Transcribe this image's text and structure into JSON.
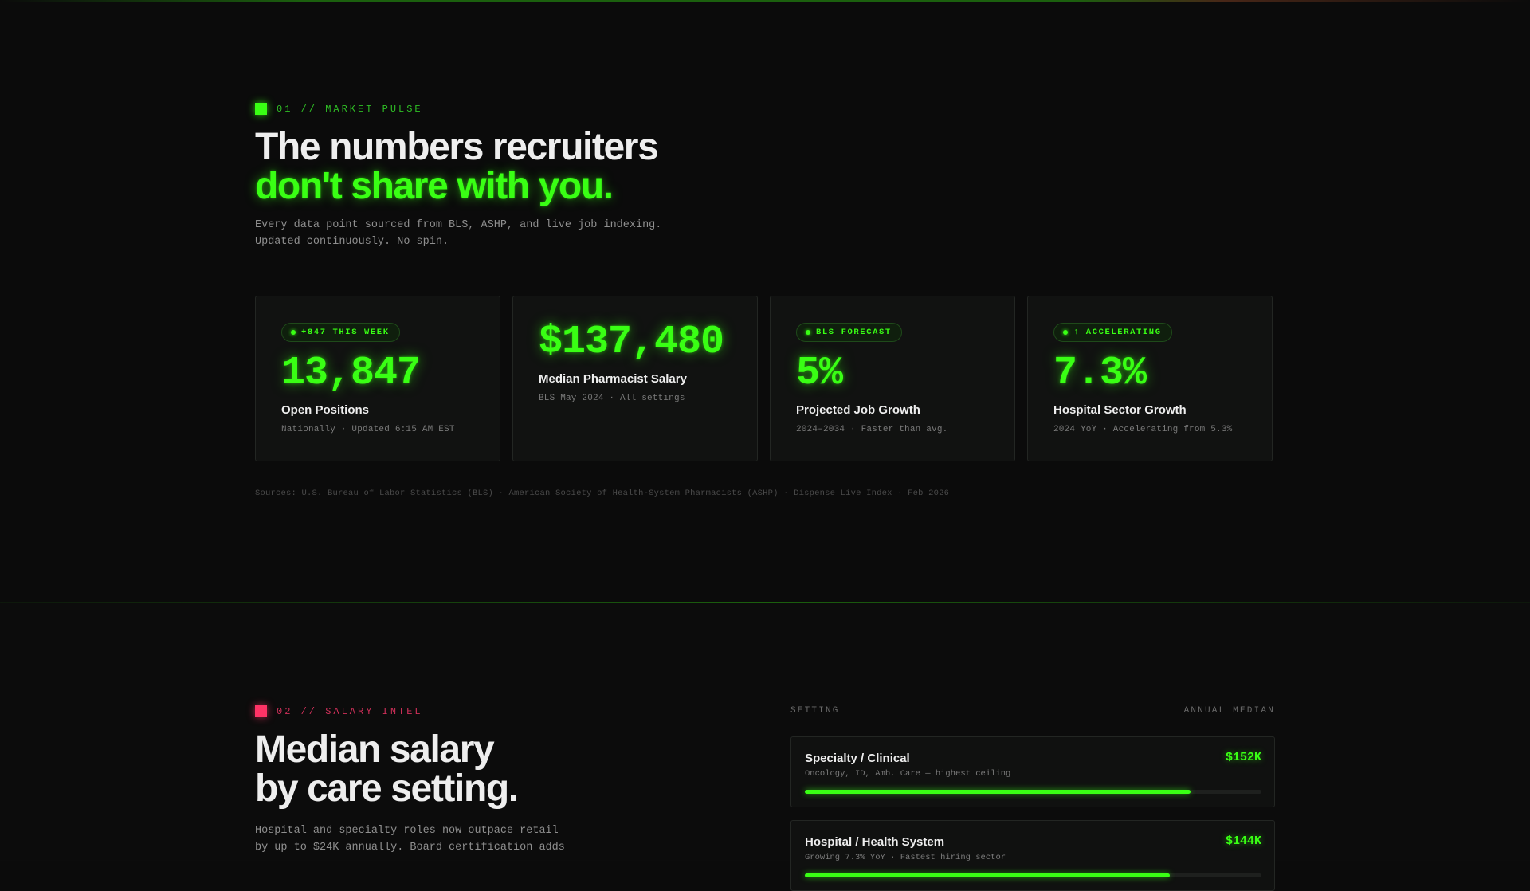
{
  "colors": {
    "accent": "#39ff14",
    "accent_secondary": "#ff3366",
    "background": "#0b0b0b",
    "card_bg": "#111211"
  },
  "market_pulse": {
    "eyebrow": "01 // MARKET PULSE",
    "heading_line1": "The numbers recruiters",
    "heading_line2": "don't share with you.",
    "subtitle_line1": "Every data point sourced from BLS, ASHP, and live job indexing.",
    "subtitle_line2": "Updated continuously. No spin.",
    "cards": [
      {
        "badge": "+847 THIS WEEK",
        "value": "13,847",
        "label": "Open Positions",
        "note": "Nationally · Updated 6:15 AM EST"
      },
      {
        "badge": "",
        "value": "$137,480",
        "label": "Median Pharmacist Salary",
        "note": "BLS May 2024 · All settings"
      },
      {
        "badge": "BLS FORECAST",
        "value": "5%",
        "label": "Projected Job Growth",
        "note": "2024–2034 · Faster than avg."
      },
      {
        "badge": "↑ ACCELERATING",
        "value": "7.3%",
        "label": "Hospital Sector Growth",
        "note": "2024 YoY · Accelerating from 5.3%"
      }
    ],
    "sources": "Sources: U.S. Bureau of Labor Statistics (BLS) · American Society of Health-System Pharmacists (ASHP) · Dispense Live Index · Feb 2026"
  },
  "salary_intel": {
    "eyebrow": "02 // SALARY INTEL",
    "heading_line1": "Median salary",
    "heading_line2": "by care setting.",
    "subtitle_line1": "Hospital and specialty roles now outpace retail",
    "subtitle_line2": "by up to $24K annually. Board certification adds",
    "column_setting": "SETTING",
    "column_median": "ANNUAL MEDIAN",
    "rows": [
      {
        "title": "Specialty / Clinical",
        "value": "$152K",
        "note": "Oncology, ID, Amb. Care — highest ceiling",
        "bar_fraction": 0.845
      },
      {
        "title": "Hospital / Health System",
        "value": "$144K",
        "note": "Growing 7.3% YoY · Fastest hiring sector",
        "bar_fraction": 0.8
      }
    ]
  }
}
